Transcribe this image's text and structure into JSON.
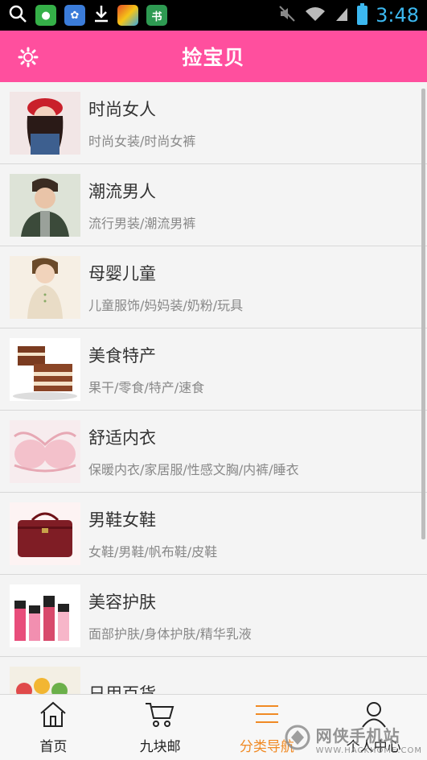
{
  "status_bar": {
    "time": "3:48",
    "app_icons": [
      "green-app-icon",
      "baidu-icon",
      "download-icon",
      "colorful-app-icon",
      "tool-app-icon"
    ],
    "app_icon_colors": [
      "#35b048",
      "#3b7cd9",
      "#ffffff",
      "#e44d26",
      "#2e9a52"
    ]
  },
  "app_bar": {
    "title": "捡宝贝",
    "color": "#ff4f9e"
  },
  "categories": [
    {
      "title": "时尚女人",
      "subtitle": "时尚女装/时尚女裤"
    },
    {
      "title": "潮流男人",
      "subtitle": "流行男装/潮流男裤"
    },
    {
      "title": "母婴儿童",
      "subtitle": "儿童服饰/妈妈装/奶粉/玩具"
    },
    {
      "title": "美食特产",
      "subtitle": "果干/零食/特产/速食"
    },
    {
      "title": "舒适内衣",
      "subtitle": "保暖内衣/家居服/性感文胸/内裤/睡衣"
    },
    {
      "title": "男鞋女鞋",
      "subtitle": "女鞋/男鞋/帆布鞋/皮鞋"
    },
    {
      "title": "美容护肤",
      "subtitle": "面部护肤/身体护肤/精华乳液"
    },
    {
      "title": "日用百货",
      "subtitle": ""
    }
  ],
  "bottom_nav": [
    {
      "label": "首页",
      "icon": "home-icon"
    },
    {
      "label": "九块邮",
      "icon": "cart-icon"
    },
    {
      "label": "分类导航",
      "icon": "menu-icon",
      "active": true
    },
    {
      "label": "个人中心",
      "icon": "user-icon"
    }
  ],
  "accent_color": "#f08a24",
  "watermark": {
    "name": "网侠手机站",
    "url": "WWW.HACKHOME.COM"
  }
}
